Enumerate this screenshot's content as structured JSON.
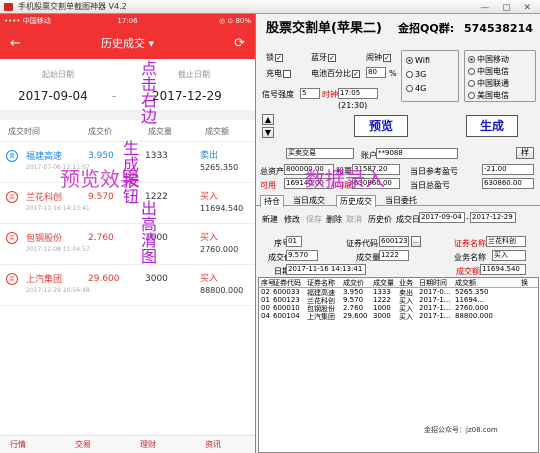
{
  "window": {
    "title": "手机股票交割单截图神器 V4.2",
    "controls": "— ▢ ✕"
  },
  "phone": {
    "status": {
      "carrier": "•••• 中国移动 ",
      "time": "17:06",
      "right": "◎ ⊙ 80%"
    },
    "nav": {
      "back": "←",
      "title": "历史成交 ▾",
      "refresh": "⟳"
    },
    "dates": {
      "start_label": "起始日期",
      "start": "2017-09-04",
      "dash": "-",
      "end_label": "截止日期",
      "end": "2017-12-29"
    },
    "columns": [
      "成交时间",
      "成交价",
      "成交量",
      "成交额"
    ],
    "trades": [
      {
        "badge": "卖",
        "side": "sell",
        "name": "福建高速",
        "time": "2017-07-06 12:11:07",
        "price": "3.950",
        "qty": "1333",
        "dir": "卖出",
        "amount": "5265.350"
      },
      {
        "badge": "买",
        "side": "buy",
        "name": "兰花科创",
        "time": "2017-11-16 14:13:41",
        "price": "9.570",
        "qty": "1222",
        "dir": "买入",
        "amount": "11694.540"
      },
      {
        "badge": "买",
        "side": "buy",
        "name": "包钢股份",
        "time": "2017-12-08 11:04:57",
        "price": "2.760",
        "qty": "1000",
        "dir": "买入",
        "amount": "2760.000"
      },
      {
        "badge": "买",
        "side": "buy",
        "name": "上汽集团",
        "time": "2017-12-29 10:56:48",
        "price": "29.600",
        "qty": "3000",
        "dir": "买入",
        "amount": "88800.000"
      }
    ],
    "tabbar": [
      "行情",
      "交易",
      "理财",
      "资讯"
    ]
  },
  "overlay": {
    "vertical1": "点击右边",
    "vertical2": "生成按钮",
    "vertical3": "出高清图",
    "preview_effect": "预览效果",
    "data_entry": "数据录入"
  },
  "panel": {
    "title": "股票交割单(苹果二)",
    "qq_label": "金招QQ群:",
    "qq": "574538214",
    "opts": {
      "lock": "锁",
      "bluetooth": "蓝牙",
      "alarm": "闹钟",
      "charging": "充电",
      "battery_pct": "电池百分比",
      "battery_val": "80",
      "pct": "%",
      "signal_label": "信号强度",
      "signal_val": "5",
      "clock_label": "时钟",
      "clock_val": "17:05",
      "clock_range": "(21:30)"
    },
    "network": [
      "Wifi",
      "3G",
      "4G"
    ],
    "carriers": [
      "中国移动",
      "中国电信",
      "中国联通",
      "美国电信"
    ],
    "preview_btn": "预览",
    "generate_btn": "生成",
    "trade_type": "买卖交易",
    "account_label": "账户",
    "account": "**9088",
    "browse_btn": "样",
    "assets_label": "总资产",
    "assets": "800000.00",
    "market_label": "股票市值",
    "market_val": "31587.20",
    "daily_pl_label": "当日参考盈亏",
    "daily_pl": "-21.00",
    "avail_label": "可用",
    "avail": "169140.00",
    "withdraw_label": "可取",
    "withdraw": "630860.00",
    "daily_total_label": "当日总盈亏",
    "daily_total": "630860.00",
    "tabs": [
      "持仓",
      "当日成交",
      "历史成交",
      "当日委托"
    ],
    "form": {
      "add": "新建",
      "edit": "修改",
      "save": "保存",
      "delete": "删除",
      "cancel": "取消",
      "hist_price": "历史价",
      "date_label": "成交日期",
      "date_from": "2017-09-04",
      "date_to": "2017-12-29",
      "seq_label": "序号",
      "seq": "01",
      "code_label": "证券代码",
      "code": "600123",
      "name_label": "证券名称",
      "name": "兰花科创",
      "price_label": "成交价",
      "price": "9.570",
      "qty_label": "成交量",
      "qty": "1222",
      "biz_label": "业务名称",
      "biz": "买入",
      "date_row_label": "日期",
      "date_val": "2017-11-16 14:13:41",
      "amount_label": "成交额",
      "amount": "11694.540"
    },
    "grid_headers": [
      "序号",
      "证券代码",
      "证券名称",
      "成交价",
      "成交量",
      "业务",
      "日期时间",
      "成交额",
      "换"
    ],
    "grid_rows": [
      [
        "02",
        "600033",
        "福建高速",
        "3.950",
        "1333",
        "卖出",
        "2017-0...",
        "5265.350"
      ],
      [
        "01",
        "600123",
        "兰花科创",
        "9.570",
        "1222",
        "买入",
        "2017-1...",
        "11694..."
      ],
      [
        "00",
        "600010",
        "包钢股份",
        "2.760",
        "1000",
        "买入",
        "2017-1...",
        "2760.000"
      ],
      [
        "04",
        "600104",
        "上汽集团",
        "29.600",
        "3000",
        "买入",
        "2017-1...",
        "88800.000"
      ]
    ]
  },
  "watermark": "金招公众号：jz08.com"
}
